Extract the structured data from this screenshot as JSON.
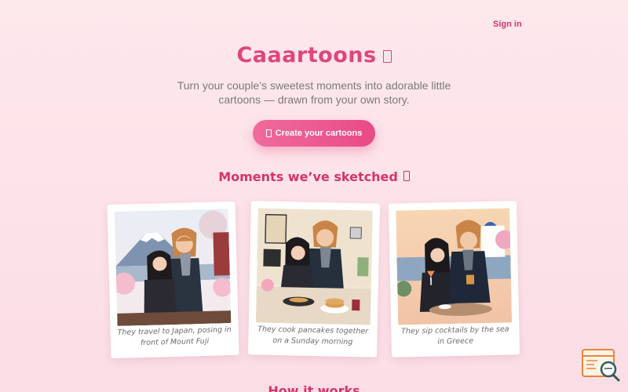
{
  "header": {
    "signin_label": "Sign in"
  },
  "hero": {
    "title": "Caaartoons",
    "subtitle": "Turn your couple’s sweetest moments into adorable little cartoons — drawn from your own story.",
    "cta_label": "Create your cartoons"
  },
  "gallery": {
    "title": "Moments we’ve sketched",
    "cards": [
      {
        "caption": "They travel to Japan, posing in front of Mount Fuji",
        "illustration": "japan-fuji-couple"
      },
      {
        "caption": "They cook pancakes together on a Sunday morning",
        "illustration": "kitchen-pancakes-couple"
      },
      {
        "caption": "They sip cocktails by the sea in Greece",
        "illustration": "greece-cocktails-couple"
      }
    ]
  },
  "next_section": {
    "title": "How it works"
  },
  "colors": {
    "accent": "#e0457b",
    "accent_dark": "#d6336c",
    "background": "#fde6eb",
    "cta_gradient_start": "#f06b9c",
    "cta_gradient_end": "#e94a86"
  },
  "icons": {
    "title_icon": "missing-glyph-icon",
    "cta_icon": "missing-glyph-icon",
    "gallery_title_icon": "missing-glyph-icon",
    "floating_widget": "search-window-icon"
  }
}
